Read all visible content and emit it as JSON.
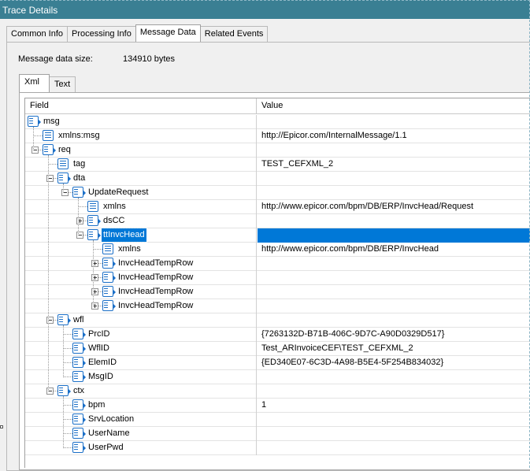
{
  "window": {
    "title": "Trace Details"
  },
  "tabs": [
    "Common Info",
    "Processing Info",
    "Message Data",
    "Related Events"
  ],
  "active_tab": "Message Data",
  "message_size": {
    "label": "Message data size:",
    "value": "134910 bytes"
  },
  "inner_tabs": [
    "Xml",
    "Text"
  ],
  "active_inner_tab": "Xml",
  "grid": {
    "headers": {
      "field": "Field",
      "value": "Value"
    },
    "rows": [
      {
        "field": "msg",
        "value": "",
        "depth": 0,
        "exp": "",
        "leaf": false
      },
      {
        "field": "xmlns:msg",
        "value": "http://Epicor.com/InternalMessage/1.1",
        "depth": 1,
        "exp": "",
        "leaf": true
      },
      {
        "field": "req",
        "value": "",
        "depth": 1,
        "exp": "minus",
        "leaf": false
      },
      {
        "field": "tag",
        "value": "TEST_CEFXML_2",
        "depth": 2,
        "exp": "",
        "leaf": true
      },
      {
        "field": "dta",
        "value": "",
        "depth": 2,
        "exp": "minus",
        "leaf": false
      },
      {
        "field": "UpdateRequest",
        "value": "",
        "depth": 3,
        "exp": "minus",
        "leaf": false
      },
      {
        "field": "xmlns",
        "value": "http://www.epicor.com/bpm/DB/ERP/InvcHead/Request",
        "depth": 4,
        "exp": "",
        "leaf": true
      },
      {
        "field": "dsCC",
        "value": "",
        "depth": 4,
        "exp": "plus",
        "leaf": false
      },
      {
        "field": "ttInvcHead",
        "value": "",
        "depth": 4,
        "exp": "minus",
        "leaf": false,
        "selected": true
      },
      {
        "field": "xmlns",
        "value": "http://www.epicor.com/bpm/DB/ERP/InvcHead",
        "depth": 5,
        "exp": "",
        "leaf": true
      },
      {
        "field": "InvcHeadTempRow",
        "value": "",
        "depth": 5,
        "exp": "plus",
        "leaf": false
      },
      {
        "field": "InvcHeadTempRow",
        "value": "",
        "depth": 5,
        "exp": "plus",
        "leaf": false
      },
      {
        "field": "InvcHeadTempRow",
        "value": "",
        "depth": 5,
        "exp": "plus",
        "leaf": false
      },
      {
        "field": "InvcHeadTempRow",
        "value": "",
        "depth": 5,
        "exp": "plus",
        "leaf": false
      },
      {
        "field": "wfl",
        "value": "",
        "depth": 2,
        "exp": "minus",
        "leaf": false
      },
      {
        "field": "PrcID",
        "value": "{7263132D-B71B-406C-9D7C-A90D0329D517}",
        "depth": 3,
        "exp": "",
        "leaf": false
      },
      {
        "field": "WflID",
        "value": "Test_ARInvoiceCEF\\TEST_CEFXML_2",
        "depth": 3,
        "exp": "",
        "leaf": false
      },
      {
        "field": "ElemID",
        "value": "{ED340E07-6C3D-4A98-B5E4-5F254B834032}",
        "depth": 3,
        "exp": "",
        "leaf": false
      },
      {
        "field": "MsgID",
        "value": "",
        "depth": 3,
        "exp": "",
        "leaf": false
      },
      {
        "field": "ctx",
        "value": "",
        "depth": 2,
        "exp": "minus",
        "leaf": false
      },
      {
        "field": "bpm",
        "value": "1",
        "depth": 3,
        "exp": "",
        "leaf": false
      },
      {
        "field": "SrvLocation",
        "value": "",
        "depth": 3,
        "exp": "",
        "leaf": false
      },
      {
        "field": "UserName",
        "value": "",
        "depth": 3,
        "exp": "",
        "leaf": false
      },
      {
        "field": "UserPwd",
        "value": "",
        "depth": 3,
        "exp": "",
        "leaf": false
      }
    ]
  }
}
